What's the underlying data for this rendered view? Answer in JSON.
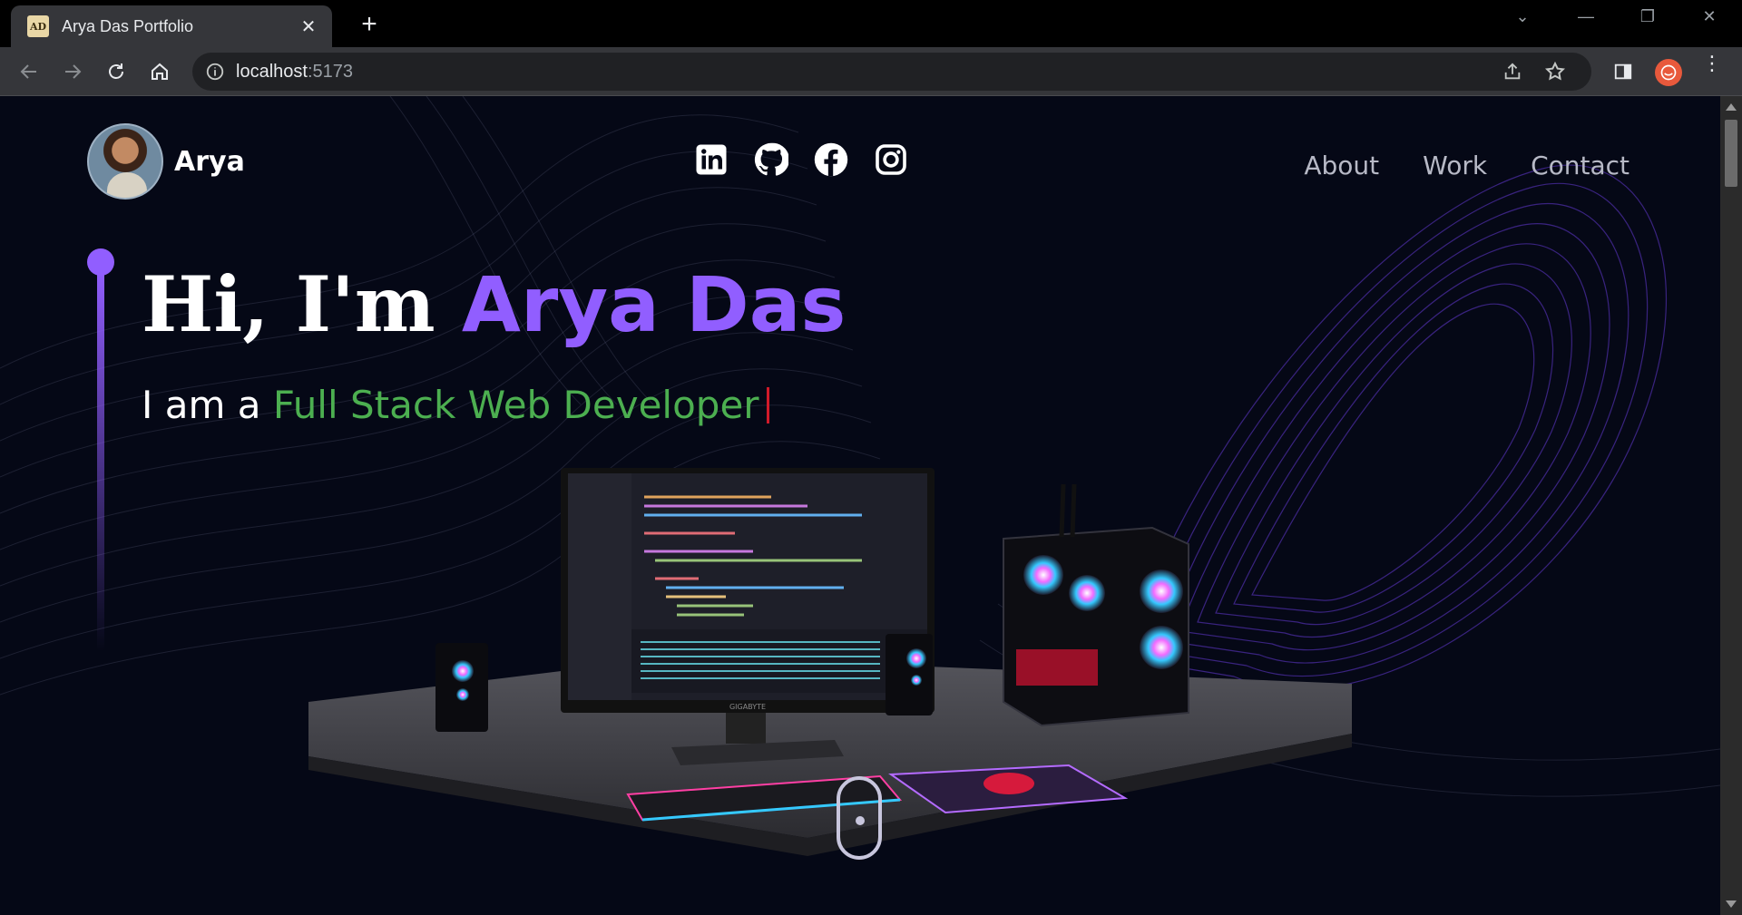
{
  "browser": {
    "tab_title": "Arya Das Portfolio",
    "favicon_text": "AD",
    "url_host": "localhost",
    "url_port": ":5173"
  },
  "nav": {
    "brand_name": "Arya",
    "social_icons": [
      "linkedin-icon",
      "github-icon",
      "facebook-icon",
      "instagram-icon"
    ],
    "links": [
      "About",
      "Work",
      "Contact"
    ]
  },
  "hero": {
    "greeting": "Hi, I'm ",
    "name": "Arya Das",
    "intro": "I am a ",
    "role": "Full Stack Web Developer"
  },
  "colors": {
    "accent": "#915eff",
    "role": "#4caf50",
    "background": "#050816",
    "caret": "#d11a2a"
  },
  "scene": {
    "monitor_brand": "GIGABYTE"
  }
}
